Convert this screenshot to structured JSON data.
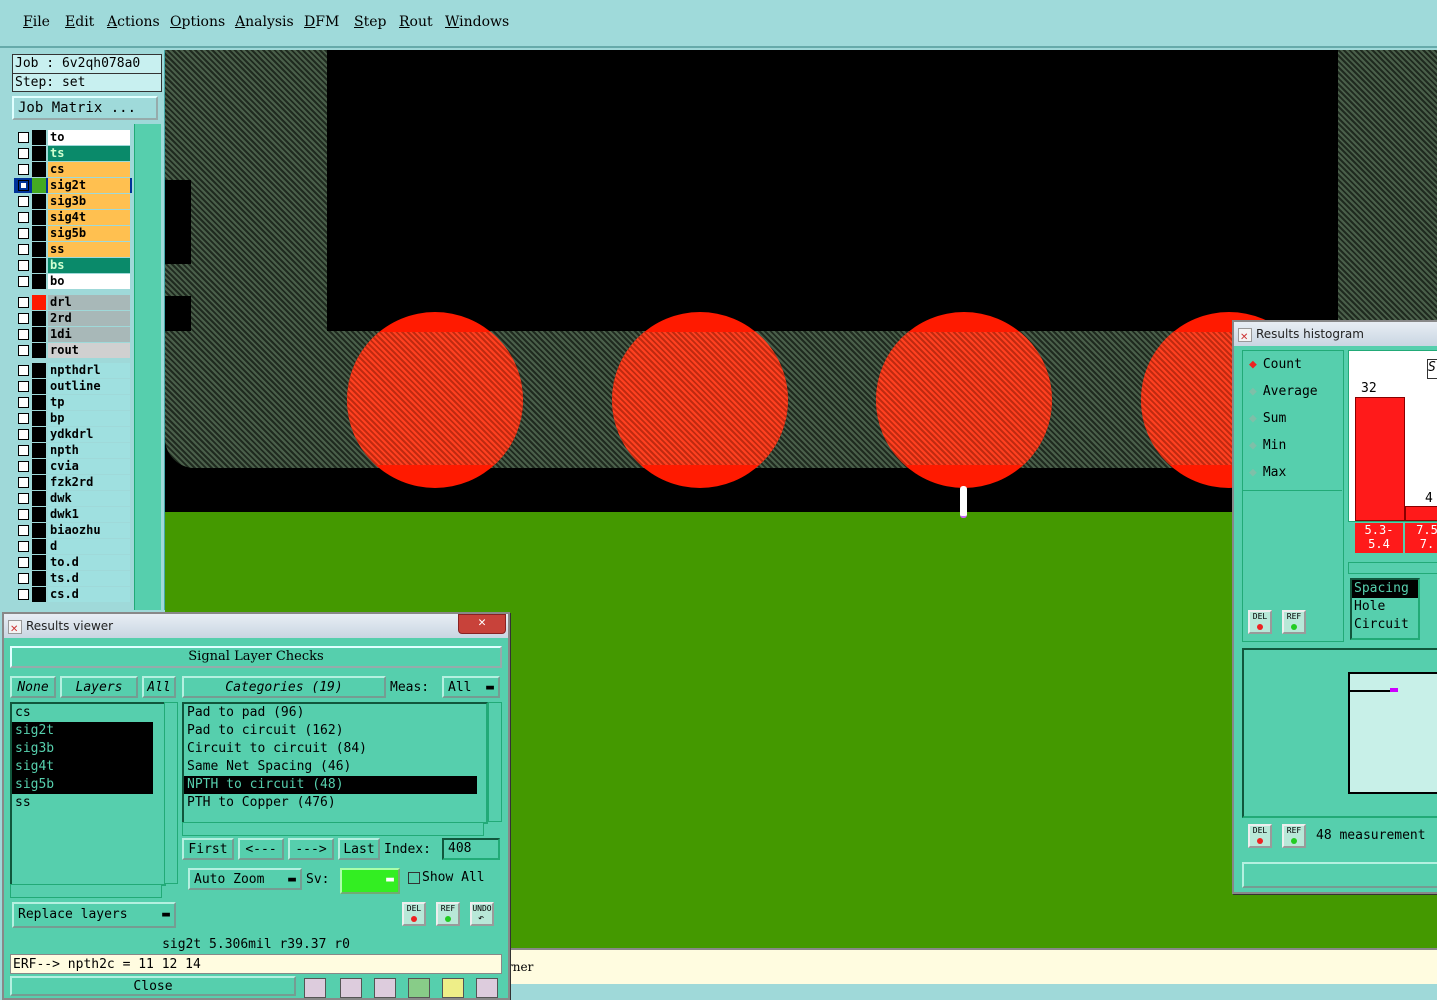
{
  "menu": [
    "File",
    "Edit",
    "Actions",
    "Options",
    "Analysis",
    "DFM",
    "Step",
    "Rout",
    "Windows"
  ],
  "job": {
    "job": "Job : 6v2qh078a0",
    "step": "Step: set",
    "matrix_button": "Job Matrix ..."
  },
  "layers_group1": [
    {
      "name": "to",
      "color": "#ffffff",
      "swatch": "#000000"
    },
    {
      "name": "ts",
      "color": "#0a8a6a",
      "swatch": "#000000"
    },
    {
      "name": "cs",
      "color": "#ffc050",
      "swatch": "#000000"
    },
    {
      "name": "sig2t",
      "color": "#ffc050",
      "swatch": "#44aa22",
      "active": true
    },
    {
      "name": "sig3b",
      "color": "#ffc050",
      "swatch": "#000000"
    },
    {
      "name": "sig4t",
      "color": "#ffc050",
      "swatch": "#000000"
    },
    {
      "name": "sig5b",
      "color": "#ffc050",
      "swatch": "#000000"
    },
    {
      "name": "ss",
      "color": "#ffc050",
      "swatch": "#000000"
    },
    {
      "name": "bs",
      "color": "#0a8a6a",
      "swatch": "#000000"
    },
    {
      "name": "bo",
      "color": "#ffffff",
      "swatch": "#000000"
    }
  ],
  "layers_group2": [
    {
      "name": "drl",
      "color": "#a8b8b8",
      "swatch": "#ff1a00"
    },
    {
      "name": "2rd",
      "color": "#a8b8b8",
      "swatch": "#000000"
    },
    {
      "name": "1di",
      "color": "#a8b8b8",
      "swatch": "#000000"
    },
    {
      "name": "rout",
      "color": "#d0d0d0",
      "swatch": "#000000"
    }
  ],
  "layers_group3": [
    "npthdrl",
    "outline",
    "tp",
    "bp",
    "ydkdrl",
    "npth",
    "cvia",
    "fzk2rd",
    "dwk",
    "dwk1",
    "biaozhu",
    "d",
    "to.d",
    "ts.d",
    "cs.d"
  ],
  "results_viewer": {
    "title": "Results viewer",
    "header": "Signal Layer Checks",
    "none": "None",
    "layers": "Layers",
    "all": "All",
    "categories_label": "Categories (19)",
    "meas_label": "Meas:",
    "meas_value": "All",
    "layer_list": [
      {
        "name": "cs",
        "selected": false
      },
      {
        "name": "sig2t",
        "selected": true
      },
      {
        "name": "sig3b",
        "selected": true
      },
      {
        "name": "sig4t",
        "selected": true
      },
      {
        "name": "sig5b",
        "selected": true
      },
      {
        "name": "ss",
        "selected": false
      }
    ],
    "categories": [
      {
        "name": "Pad to pad (96)",
        "selected": false
      },
      {
        "name": "Pad to circuit (162)",
        "selected": false
      },
      {
        "name": "Circuit to circuit (84)",
        "selected": false
      },
      {
        "name": "Same Net Spacing (46)",
        "selected": false
      },
      {
        "name": "NPTH to circuit (48)",
        "selected": true
      },
      {
        "name": "PTH to Copper (476)",
        "selected": false
      }
    ],
    "first": "First",
    "prev": "<---",
    "next": "--->",
    "last": "Last",
    "index_label": "Index:",
    "index_value": "408",
    "auto_zoom": "Auto Zoom",
    "sv_label": "Sv:",
    "show_all": "Show All",
    "replace_layers": "Replace layers",
    "del": "DEL",
    "ref": "REF",
    "undo": "UNDO",
    "info": "sig2t 5.306mil  r39.37  r0",
    "erf": "ERF--> npth2c = 11 12 14",
    "close": "Close"
  },
  "histogram": {
    "title": "Results histogram",
    "modes": [
      {
        "label": "Count",
        "selected": true
      },
      {
        "label": "Average",
        "selected": false
      },
      {
        "label": "Sum",
        "selected": false
      },
      {
        "label": "Min",
        "selected": false
      },
      {
        "label": "Max",
        "selected": false
      }
    ],
    "bars": [
      {
        "range_top": "5.3-",
        "range_bottom": "5.4",
        "count": 32
      },
      {
        "range_top": "7.5",
        "range_bottom": "7.",
        "count": 4
      }
    ],
    "scale_label": "S",
    "types": [
      "Spacing",
      "Hole",
      "Circuit"
    ],
    "del": "DEL",
    "ref": "REF",
    "measurements": "48 measurement"
  },
  "status": {
    "text": "rner"
  }
}
